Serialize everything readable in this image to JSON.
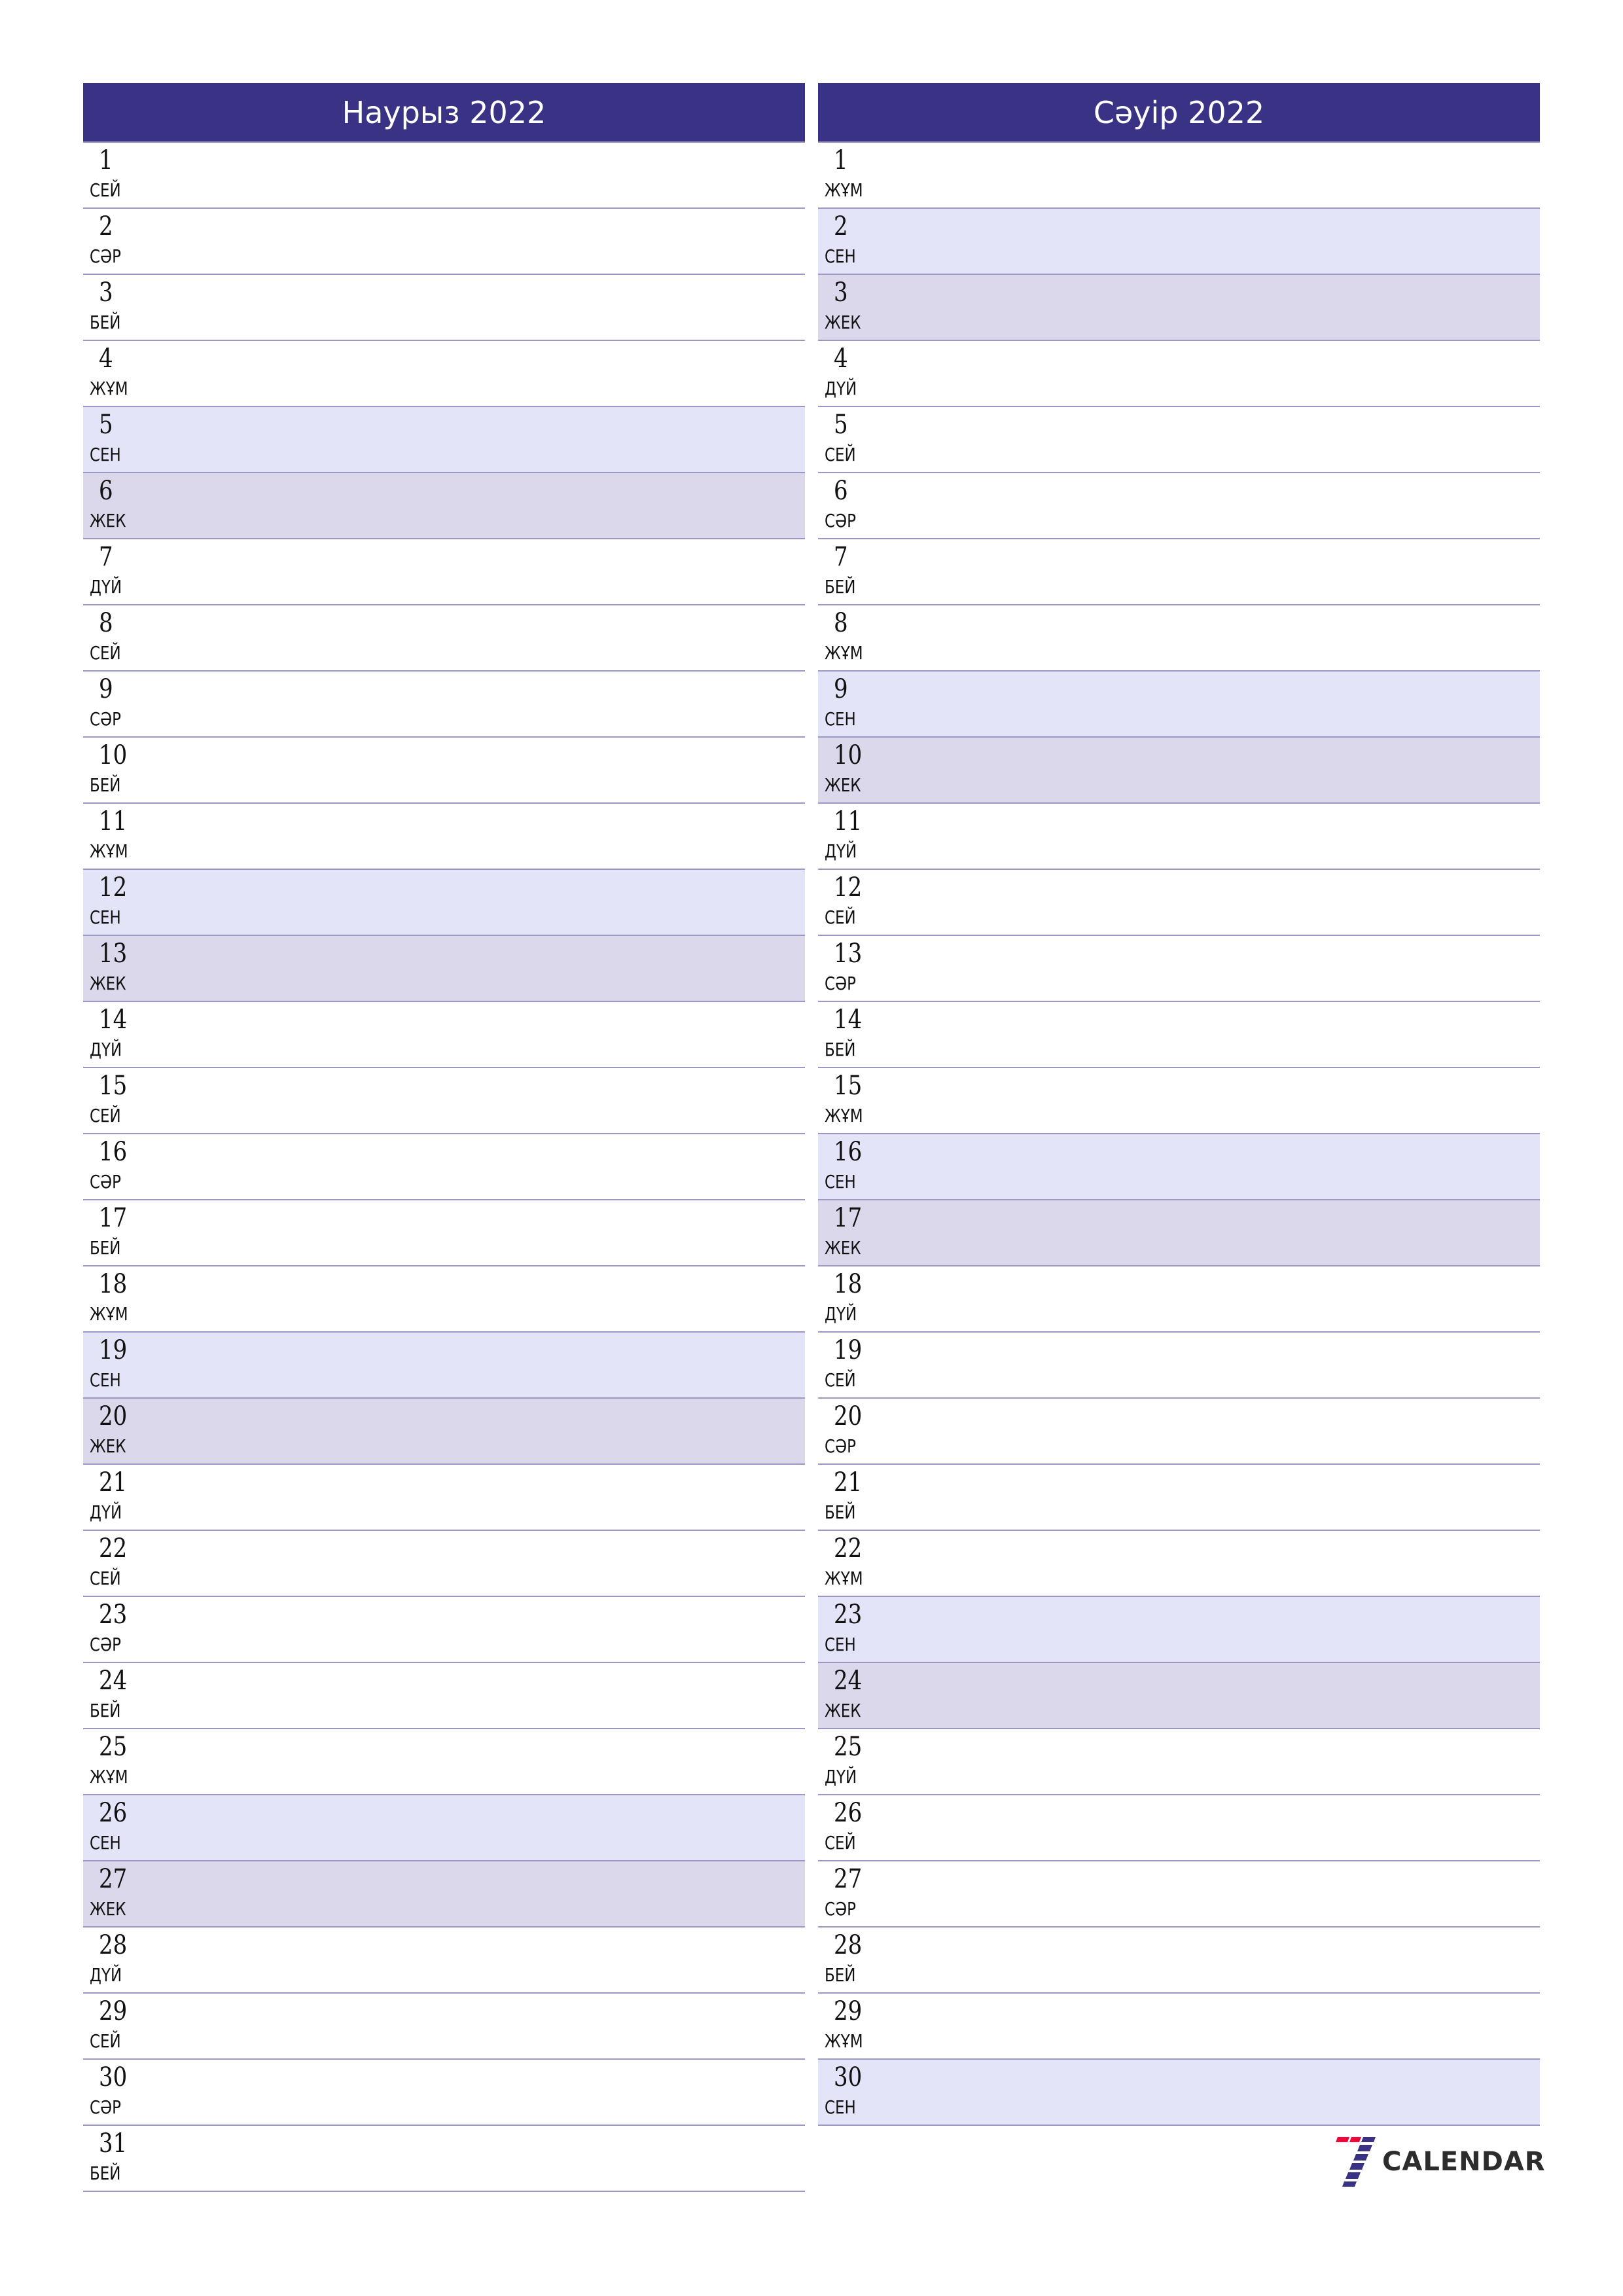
{
  "colors": {
    "header": "#3A3385",
    "saturday": "#E4E4F8",
    "sunday": "#DCD8EC",
    "divider": "#9C98C6",
    "logo_red": "#F0083A",
    "logo_blue": "#3A3385"
  },
  "months": [
    {
      "title": "Наурыз 2022",
      "days": [
        {
          "num": "1",
          "name": "СЕЙ",
          "type": ""
        },
        {
          "num": "2",
          "name": "СӘР",
          "type": ""
        },
        {
          "num": "3",
          "name": "БЕЙ",
          "type": ""
        },
        {
          "num": "4",
          "name": "ЖҰМ",
          "type": ""
        },
        {
          "num": "5",
          "name": "СЕН",
          "type": "sat"
        },
        {
          "num": "6",
          "name": "ЖЕК",
          "type": "sun"
        },
        {
          "num": "7",
          "name": "ДҮЙ",
          "type": ""
        },
        {
          "num": "8",
          "name": "СЕЙ",
          "type": ""
        },
        {
          "num": "9",
          "name": "СӘР",
          "type": ""
        },
        {
          "num": "10",
          "name": "БЕЙ",
          "type": ""
        },
        {
          "num": "11",
          "name": "ЖҰМ",
          "type": ""
        },
        {
          "num": "12",
          "name": "СЕН",
          "type": "sat"
        },
        {
          "num": "13",
          "name": "ЖЕК",
          "type": "sun"
        },
        {
          "num": "14",
          "name": "ДҮЙ",
          "type": ""
        },
        {
          "num": "15",
          "name": "СЕЙ",
          "type": ""
        },
        {
          "num": "16",
          "name": "СӘР",
          "type": ""
        },
        {
          "num": "17",
          "name": "БЕЙ",
          "type": ""
        },
        {
          "num": "18",
          "name": "ЖҰМ",
          "type": ""
        },
        {
          "num": "19",
          "name": "СЕН",
          "type": "sat"
        },
        {
          "num": "20",
          "name": "ЖЕК",
          "type": "sun"
        },
        {
          "num": "21",
          "name": "ДҮЙ",
          "type": ""
        },
        {
          "num": "22",
          "name": "СЕЙ",
          "type": ""
        },
        {
          "num": "23",
          "name": "СӘР",
          "type": ""
        },
        {
          "num": "24",
          "name": "БЕЙ",
          "type": ""
        },
        {
          "num": "25",
          "name": "ЖҰМ",
          "type": ""
        },
        {
          "num": "26",
          "name": "СЕН",
          "type": "sat"
        },
        {
          "num": "27",
          "name": "ЖЕК",
          "type": "sun"
        },
        {
          "num": "28",
          "name": "ДҮЙ",
          "type": ""
        },
        {
          "num": "29",
          "name": "СЕЙ",
          "type": ""
        },
        {
          "num": "30",
          "name": "СӘР",
          "type": ""
        },
        {
          "num": "31",
          "name": "БЕЙ",
          "type": ""
        }
      ]
    },
    {
      "title": "Сәуір 2022",
      "days": [
        {
          "num": "1",
          "name": "ЖҰМ",
          "type": ""
        },
        {
          "num": "2",
          "name": "СЕН",
          "type": "sat"
        },
        {
          "num": "3",
          "name": "ЖЕК",
          "type": "sun"
        },
        {
          "num": "4",
          "name": "ДҮЙ",
          "type": ""
        },
        {
          "num": "5",
          "name": "СЕЙ",
          "type": ""
        },
        {
          "num": "6",
          "name": "СӘР",
          "type": ""
        },
        {
          "num": "7",
          "name": "БЕЙ",
          "type": ""
        },
        {
          "num": "8",
          "name": "ЖҰМ",
          "type": ""
        },
        {
          "num": "9",
          "name": "СЕН",
          "type": "sat"
        },
        {
          "num": "10",
          "name": "ЖЕК",
          "type": "sun"
        },
        {
          "num": "11",
          "name": "ДҮЙ",
          "type": ""
        },
        {
          "num": "12",
          "name": "СЕЙ",
          "type": ""
        },
        {
          "num": "13",
          "name": "СӘР",
          "type": ""
        },
        {
          "num": "14",
          "name": "БЕЙ",
          "type": ""
        },
        {
          "num": "15",
          "name": "ЖҰМ",
          "type": ""
        },
        {
          "num": "16",
          "name": "СЕН",
          "type": "sat"
        },
        {
          "num": "17",
          "name": "ЖЕК",
          "type": "sun"
        },
        {
          "num": "18",
          "name": "ДҮЙ",
          "type": ""
        },
        {
          "num": "19",
          "name": "СЕЙ",
          "type": ""
        },
        {
          "num": "20",
          "name": "СӘР",
          "type": ""
        },
        {
          "num": "21",
          "name": "БЕЙ",
          "type": ""
        },
        {
          "num": "22",
          "name": "ЖҰМ",
          "type": ""
        },
        {
          "num": "23",
          "name": "СЕН",
          "type": "sat"
        },
        {
          "num": "24",
          "name": "ЖЕК",
          "type": "sun"
        },
        {
          "num": "25",
          "name": "ДҮЙ",
          "type": ""
        },
        {
          "num": "26",
          "name": "СЕЙ",
          "type": ""
        },
        {
          "num": "27",
          "name": "СӘР",
          "type": ""
        },
        {
          "num": "28",
          "name": "БЕЙ",
          "type": ""
        },
        {
          "num": "29",
          "name": "ЖҰМ",
          "type": ""
        },
        {
          "num": "30",
          "name": "СЕН",
          "type": "sat"
        }
      ]
    }
  ],
  "logo": {
    "text": "CALENDAR",
    "icon": "seven-logo-icon"
  }
}
